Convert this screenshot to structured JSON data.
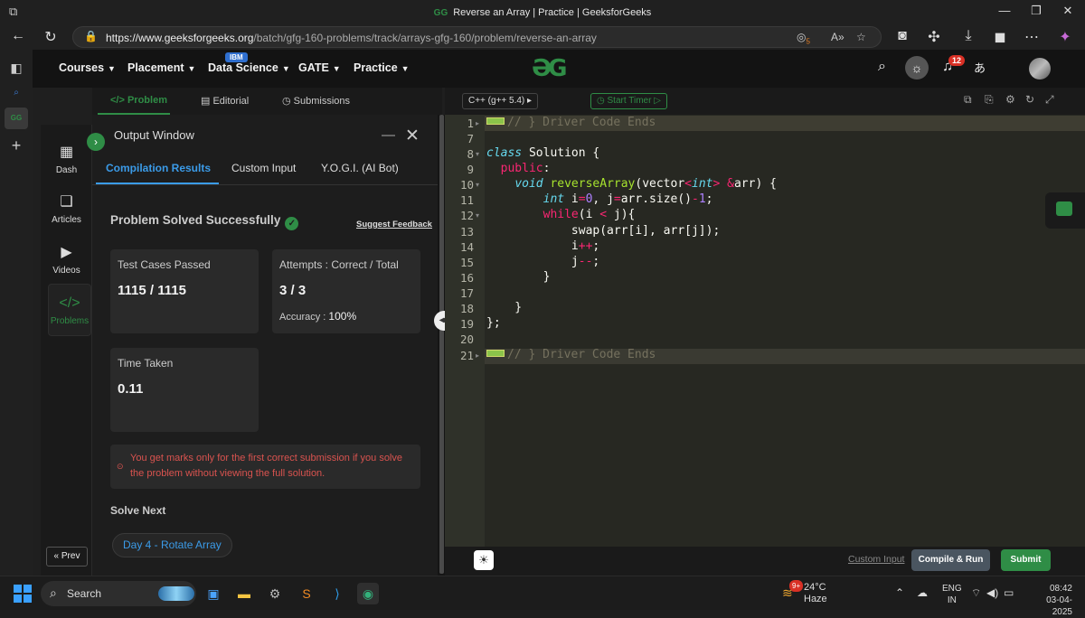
{
  "browser": {
    "tab_title": "Reverse an Array | Practice | GeeksforGeeks",
    "tab_favicon": "gfg-icon",
    "url_host": "https://www.geeksforgeeks.org",
    "url_path": "/batch/gfg-160-problems/track/arrays-gfg-160/problem/reverse-an-array",
    "tracker_count": "5"
  },
  "header": {
    "menu": [
      {
        "label": "Courses"
      },
      {
        "label": "Placement"
      },
      {
        "label": "Data Science"
      },
      {
        "label": "GATE"
      },
      {
        "label": "Practice"
      }
    ],
    "ibm_badge": "IBM",
    "notification_count": "12"
  },
  "subtabs": [
    {
      "label": "Problem"
    },
    {
      "label": "Editorial"
    },
    {
      "label": "Submissions"
    }
  ],
  "gfg_nav": [
    {
      "label": "Dash"
    },
    {
      "label": "Articles"
    },
    {
      "label": "Videos"
    },
    {
      "label": "Problems"
    }
  ],
  "prev_label": "« Prev",
  "output": {
    "title": "Output Window",
    "tabs": [
      {
        "label": "Compilation Results"
      },
      {
        "label": "Custom Input"
      },
      {
        "label": "Y.O.G.I. (AI Bot)"
      }
    ],
    "status": "Problem Solved Successfully",
    "feedback": "Suggest Feedback",
    "test_cases_label": "Test Cases Passed",
    "test_cases_value": "1115 / 1115",
    "attempts_label": "Attempts : Correct / Total",
    "attempts_value": "3 / 3",
    "accuracy_label": "Accuracy :",
    "accuracy_value": "100%",
    "time_label": "Time Taken",
    "time_value": "0.11",
    "warning": "You get marks only for the first correct submission if you solve the problem without viewing the full solution.",
    "solve_next_label": "Solve Next",
    "next_problem": "Day 4 - Rotate Array"
  },
  "editor": {
    "language": "C++ (g++ 5.4)",
    "timer_label": "Start Timer",
    "line_numbers": [
      "1",
      "7",
      "8",
      "9",
      "10",
      "11",
      "12",
      "13",
      "14",
      "15",
      "16",
      "17",
      "18",
      "19",
      "20",
      "21"
    ],
    "comment_text": "// } Driver Code Ends"
  },
  "bottom": {
    "custom_input": "Custom Input",
    "compile_run": "Compile & Run",
    "submit": "Submit"
  },
  "taskbar": {
    "search_label": "Search",
    "weather_temp": "24°C",
    "weather_desc": "Haze",
    "weather_badge": "9+",
    "lang_line1": "ENG",
    "lang_line2": "IN",
    "time": "08:42",
    "date": "03-04-2025"
  }
}
